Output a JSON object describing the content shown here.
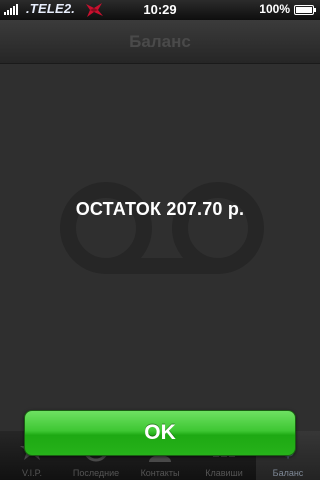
{
  "status_bar": {
    "carrier": ".TELE2.",
    "time": "10:29",
    "battery_percent": "100%",
    "battery_level": 1.0
  },
  "nav": {
    "title": "Баланс"
  },
  "main": {
    "balance_text": "ОСТАТОК 207.70 р.",
    "background_icon": "voicemail-icon"
  },
  "dialog": {
    "ok_label": "OK"
  },
  "tab_bar": {
    "active_tab": "Баланс",
    "tabs": [
      {
        "label": "V.I.P.",
        "icon": "star-icon"
      },
      {
        "label": "Последние",
        "icon": "clock-icon"
      },
      {
        "label": "Контакты",
        "icon": "person-icon"
      },
      {
        "label": "Клавиши",
        "icon": "keypad-icon"
      },
      {
        "label": "Баланс",
        "icon": "dollar-icon"
      }
    ]
  },
  "colors": {
    "ok_button": "#2fb824",
    "background": "#2f2f2f"
  }
}
